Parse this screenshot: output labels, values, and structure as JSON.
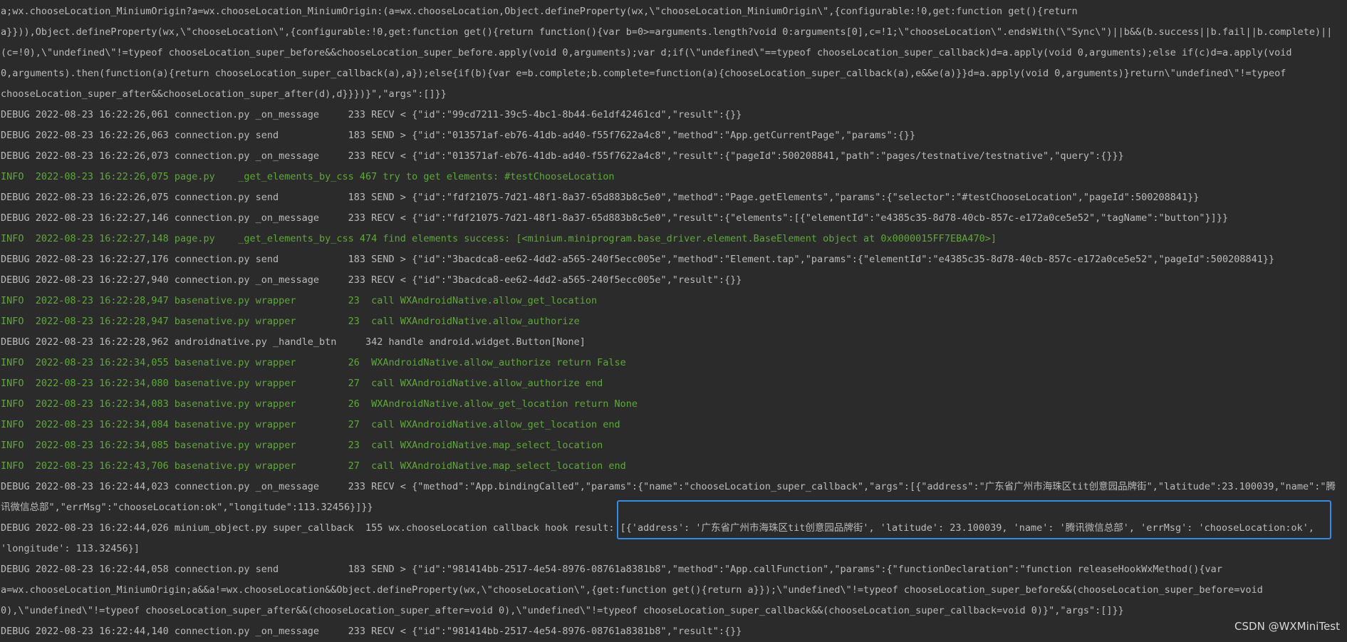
{
  "console": {
    "lines": [
      {
        "level": "debug",
        "text": "a;wx.chooseLocation_MiniumOrigin?a=wx.chooseLocation_MiniumOrigin:(a=wx.chooseLocation,Object.defineProperty(wx,\\\"chooseLocation_MiniumOrigin\\\",{configurable:!0,get:function get(){return"
      },
      {
        "level": "debug",
        "text": "a}})),Object.defineProperty(wx,\\\"chooseLocation\\\",{configurable:!0,get:function get(){return function(){var b=0>=arguments.length?void 0:arguments[0],c=!1;\\\"chooseLocation\\\".endsWith(\\\"Sync\\\")||b&&(b.success||b.fail||b.complete)||"
      },
      {
        "level": "debug",
        "text": "(c=!0),\\\"undefined\\\"!=typeof chooseLocation_super_before&&chooseLocation_super_before.apply(void 0,arguments);var d;if(\\\"undefined\\\"==typeof chooseLocation_super_callback)d=a.apply(void 0,arguments);else if(c)d=a.apply(void"
      },
      {
        "level": "debug",
        "text": "0,arguments).then(function(a){return chooseLocation_super_callback(a),a});else{if(b){var e=b.complete;b.complete=function(a){chooseLocation_super_callback(a),e&&e(a)}}d=a.apply(void 0,arguments)}return\\\"undefined\\\"!=typeof"
      },
      {
        "level": "debug",
        "text": "chooseLocation_super_after&&chooseLocation_super_after(d),d}}})}\",\"args\":[]}}"
      },
      {
        "level": "debug",
        "text": "DEBUG 2022-08-23 16:22:26,061 connection.py _on_message     233 RECV < {\"id\":\"99cd7211-39c5-4bc1-8b44-6e1df42461cd\",\"result\":{}}"
      },
      {
        "level": "debug",
        "text": "DEBUG 2022-08-23 16:22:26,063 connection.py send            183 SEND > {\"id\":\"013571af-eb76-41db-ad40-f55f7622a4c8\",\"method\":\"App.getCurrentPage\",\"params\":{}}"
      },
      {
        "level": "debug",
        "text": "DEBUG 2022-08-23 16:22:26,073 connection.py _on_message     233 RECV < {\"id\":\"013571af-eb76-41db-ad40-f55f7622a4c8\",\"result\":{\"pageId\":500208841,\"path\":\"pages/testnative/testnative\",\"query\":{}}}"
      },
      {
        "level": "info",
        "text": "INFO  2022-08-23 16:22:26,075 page.py    _get_elements_by_css 467 try to get elements: #testChooseLocation"
      },
      {
        "level": "debug",
        "text": "DEBUG 2022-08-23 16:22:26,075 connection.py send            183 SEND > {\"id\":\"fdf21075-7d21-48f1-8a37-65d883b8c5e0\",\"method\":\"Page.getElements\",\"params\":{\"selector\":\"#testChooseLocation\",\"pageId\":500208841}}"
      },
      {
        "level": "debug",
        "text": "DEBUG 2022-08-23 16:22:27,146 connection.py _on_message     233 RECV < {\"id\":\"fdf21075-7d21-48f1-8a37-65d883b8c5e0\",\"result\":{\"elements\":[{\"elementId\":\"e4385c35-8d78-40cb-857c-e172a0ce5e52\",\"tagName\":\"button\"}]}}"
      },
      {
        "level": "info",
        "text": "INFO  2022-08-23 16:22:27,148 page.py    _get_elements_by_css 474 find elements success: [<minium.miniprogram.base_driver.element.BaseElement object at 0x0000015FF7EBA470>]"
      },
      {
        "level": "debug",
        "text": "DEBUG 2022-08-23 16:22:27,176 connection.py send            183 SEND > {\"id\":\"3bacdca8-ee62-4dd2-a565-240f5ecc005e\",\"method\":\"Element.tap\",\"params\":{\"elementId\":\"e4385c35-8d78-40cb-857c-e172a0ce5e52\",\"pageId\":500208841}}"
      },
      {
        "level": "debug",
        "text": "DEBUG 2022-08-23 16:22:27,940 connection.py _on_message     233 RECV < {\"id\":\"3bacdca8-ee62-4dd2-a565-240f5ecc005e\",\"result\":{}}"
      },
      {
        "level": "info",
        "text": "INFO  2022-08-23 16:22:28,947 basenative.py wrapper         23  call WXAndroidNative.allow_get_location"
      },
      {
        "level": "info",
        "text": "INFO  2022-08-23 16:22:28,947 basenative.py wrapper         23  call WXAndroidNative.allow_authorize"
      },
      {
        "level": "debug",
        "text": "DEBUG 2022-08-23 16:22:28,962 androidnative.py _handle_btn     342 handle android.widget.Button[None]"
      },
      {
        "level": "info",
        "text": "INFO  2022-08-23 16:22:34,055 basenative.py wrapper         26  WXAndroidNative.allow_authorize return False"
      },
      {
        "level": "info",
        "text": "INFO  2022-08-23 16:22:34,080 basenative.py wrapper         27  call WXAndroidNative.allow_authorize end"
      },
      {
        "level": "info",
        "text": "INFO  2022-08-23 16:22:34,083 basenative.py wrapper         26  WXAndroidNative.allow_get_location return None"
      },
      {
        "level": "info",
        "text": "INFO  2022-08-23 16:22:34,084 basenative.py wrapper         27  call WXAndroidNative.allow_get_location end"
      },
      {
        "level": "info",
        "text": "INFO  2022-08-23 16:22:34,085 basenative.py wrapper         23  call WXAndroidNative.map_select_location"
      },
      {
        "level": "info",
        "text": "INFO  2022-08-23 16:22:43,706 basenative.py wrapper         27  call WXAndroidNative.map_select_location end"
      },
      {
        "level": "debug",
        "text": "DEBUG 2022-08-23 16:22:44,023 connection.py _on_message     233 RECV < {\"method\":\"App.bindingCalled\",\"params\":{\"name\":\"chooseLocation_super_callback\",\"args\":[{\"address\":\"广东省广州市海珠区tit创意园品牌街\",\"latitude\":23.100039,\"name\":\"腾"
      },
      {
        "level": "debug",
        "text": "讯微信总部\",\"errMsg\":\"chooseLocation:ok\",\"longitude\":113.32456}]}}"
      },
      {
        "level": "debug",
        "text": "DEBUG 2022-08-23 16:22:44,026 minium_object.py super_callback  155 wx.chooseLocation callback hook result: [{'address': '广东省广州市海珠区tit创意园品牌街', 'latitude': 23.100039, 'name': '腾讯微信总部', 'errMsg': 'chooseLocation:ok',"
      },
      {
        "level": "debug",
        "text": "'longitude': 113.32456}]"
      },
      {
        "level": "debug",
        "text": "DEBUG 2022-08-23 16:22:44,058 connection.py send            183 SEND > {\"id\":\"981414bb-2517-4e54-8976-08761a8381b8\",\"method\":\"App.callFunction\",\"params\":{\"functionDeclaration\":\"function releaseHookWxMethod(){var"
      },
      {
        "level": "debug",
        "text": "a=wx.chooseLocation_MiniumOrigin;a&&a!=wx.chooseLocation&&Object.defineProperty(wx,\\\"chooseLocation\\\",{get:function get(){return a}});\\\"undefined\\\"!=typeof chooseLocation_super_before&&(chooseLocation_super_before=void"
      },
      {
        "level": "debug",
        "text": "0),\\\"undefined\\\"!=typeof chooseLocation_super_after&&(chooseLocation_super_after=void 0),\\\"undefined\\\"!=typeof chooseLocation_super_callback&&(chooseLocation_super_callback=void 0)}\",\"args\":[]}}"
      },
      {
        "level": "debug",
        "text": "DEBUG 2022-08-23 16:22:44,140 connection.py _on_message     233 RECV < {\"id\":\"981414bb-2517-4e54-8976-08761a8381b8\",\"result\":{}}"
      }
    ]
  },
  "watermark": "CSDN @WXMiniTest",
  "colors": {
    "background": "#2b2b2b",
    "debug_text": "#bbbbbb",
    "info_text": "#5fa83a",
    "highlight_border": "#2f8fe6"
  }
}
